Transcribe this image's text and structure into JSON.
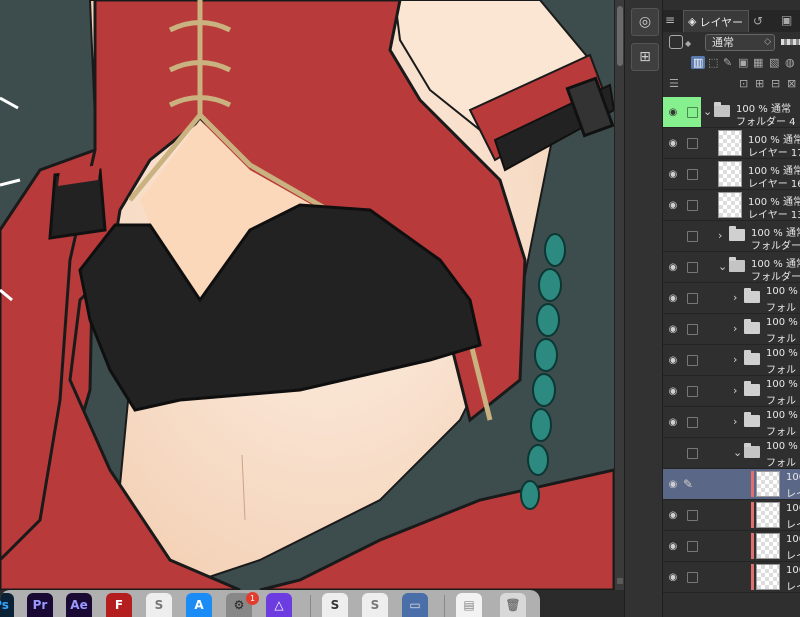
{
  "colors": {
    "canvas_bg": "#3d4d4e",
    "dress_red": "#b93a3a",
    "trim_gold": "#c9b27f",
    "top_black": "#222222",
    "skin": "#fbe9d9",
    "braid_teal": "#2c8a80",
    "layer_selected": "#5a6786",
    "visibility_green": "#86f08e",
    "clip_red": "#e07070"
  },
  "icons": {
    "eye": "eye-icon",
    "folder": "folder-icon",
    "pencil": "pencil-icon",
    "layers_tab": "layers-icon"
  },
  "layer_panel": {
    "tab_label": "レイヤー",
    "blend_mode": "通常",
    "layers": [
      {
        "kind": "folder",
        "depth": 0,
        "l1": "100 % 通常",
        "l2": "フォルダー 4",
        "open": true,
        "visible": true,
        "green": true
      },
      {
        "kind": "layer",
        "depth": 1,
        "l1": "100 % 通常",
        "l2": "レイヤー 17",
        "visible": true
      },
      {
        "kind": "layer",
        "depth": 1,
        "l1": "100 % 通常",
        "l2": "レイヤー 16",
        "visible": true
      },
      {
        "kind": "layer",
        "depth": 1,
        "l1": "100 % 通常",
        "l2": "レイヤー 13",
        "visible": true
      },
      {
        "kind": "folder",
        "depth": 1,
        "l1": "100 % 通常",
        "l2": "フォルダー",
        "open": false,
        "visible": false
      },
      {
        "kind": "folder",
        "depth": 1,
        "l1": "100 % 通常",
        "l2": "フォルダー",
        "open": true,
        "visible": true
      },
      {
        "kind": "folder",
        "depth": 2,
        "l1": "100 %",
        "l2": "フォル",
        "open": false,
        "visible": true
      },
      {
        "kind": "folder",
        "depth": 2,
        "l1": "100 %",
        "l2": "フォル",
        "open": false,
        "visible": true
      },
      {
        "kind": "folder",
        "depth": 2,
        "l1": "100 %",
        "l2": "フォル",
        "open": false,
        "visible": true
      },
      {
        "kind": "folder",
        "depth": 2,
        "l1": "100 %",
        "l2": "フォル",
        "open": false,
        "visible": true
      },
      {
        "kind": "folder",
        "depth": 2,
        "l1": "100 %",
        "l2": "フォル",
        "open": false,
        "visible": true
      },
      {
        "kind": "folder",
        "depth": 2,
        "l1": "100 %",
        "l2": "フォル",
        "open": true,
        "visible": false
      },
      {
        "kind": "layer",
        "depth": 3,
        "l1": "100",
        "l2": "レイ",
        "visible": true,
        "selected": true,
        "clip": true,
        "editing": true
      },
      {
        "kind": "layer",
        "depth": 3,
        "l1": "100",
        "l2": "レイ",
        "visible": true,
        "clip": true
      },
      {
        "kind": "layer",
        "depth": 3,
        "l1": "100",
        "l2": "レイ",
        "visible": true,
        "clip": true
      },
      {
        "kind": "layer",
        "depth": 3,
        "l1": "100",
        "l2": "レイ",
        "visible": true,
        "clip": true
      }
    ]
  },
  "dock": {
    "apps": [
      {
        "label": "Ps",
        "bg": "#0b2136",
        "fg": "#31a8ff"
      },
      {
        "label": "Pr",
        "bg": "#1a0a33",
        "fg": "#9999ff"
      },
      {
        "label": "Ae",
        "bg": "#1a0a33",
        "fg": "#9999ff"
      },
      {
        "label": "F",
        "bg": "#b41e1e",
        "fg": "#ffffff"
      },
      {
        "label": "S",
        "bg": "#eeeeee",
        "fg": "#777777"
      },
      {
        "label": "A",
        "bg": "#1b8cf5",
        "fg": "#ffffff"
      },
      {
        "label": "⚙",
        "bg": "#888888",
        "fg": "#222222"
      },
      {
        "label": "△",
        "bg": "#6c3ce0",
        "fg": "#ffffff"
      },
      {
        "label": "S",
        "bg": "#eeeeee",
        "fg": "#333333"
      },
      {
        "label": "S",
        "bg": "#eeeeee",
        "fg": "#777777"
      },
      {
        "label": "▭",
        "bg": "#4a6fa8",
        "fg": "#dddddd"
      },
      {
        "label": "▤",
        "bg": "#f2f2f2",
        "fg": "#888888"
      },
      {
        "label": "🗑",
        "bg": "#d8d8d8",
        "fg": "#777777"
      }
    ],
    "badge": "1"
  }
}
